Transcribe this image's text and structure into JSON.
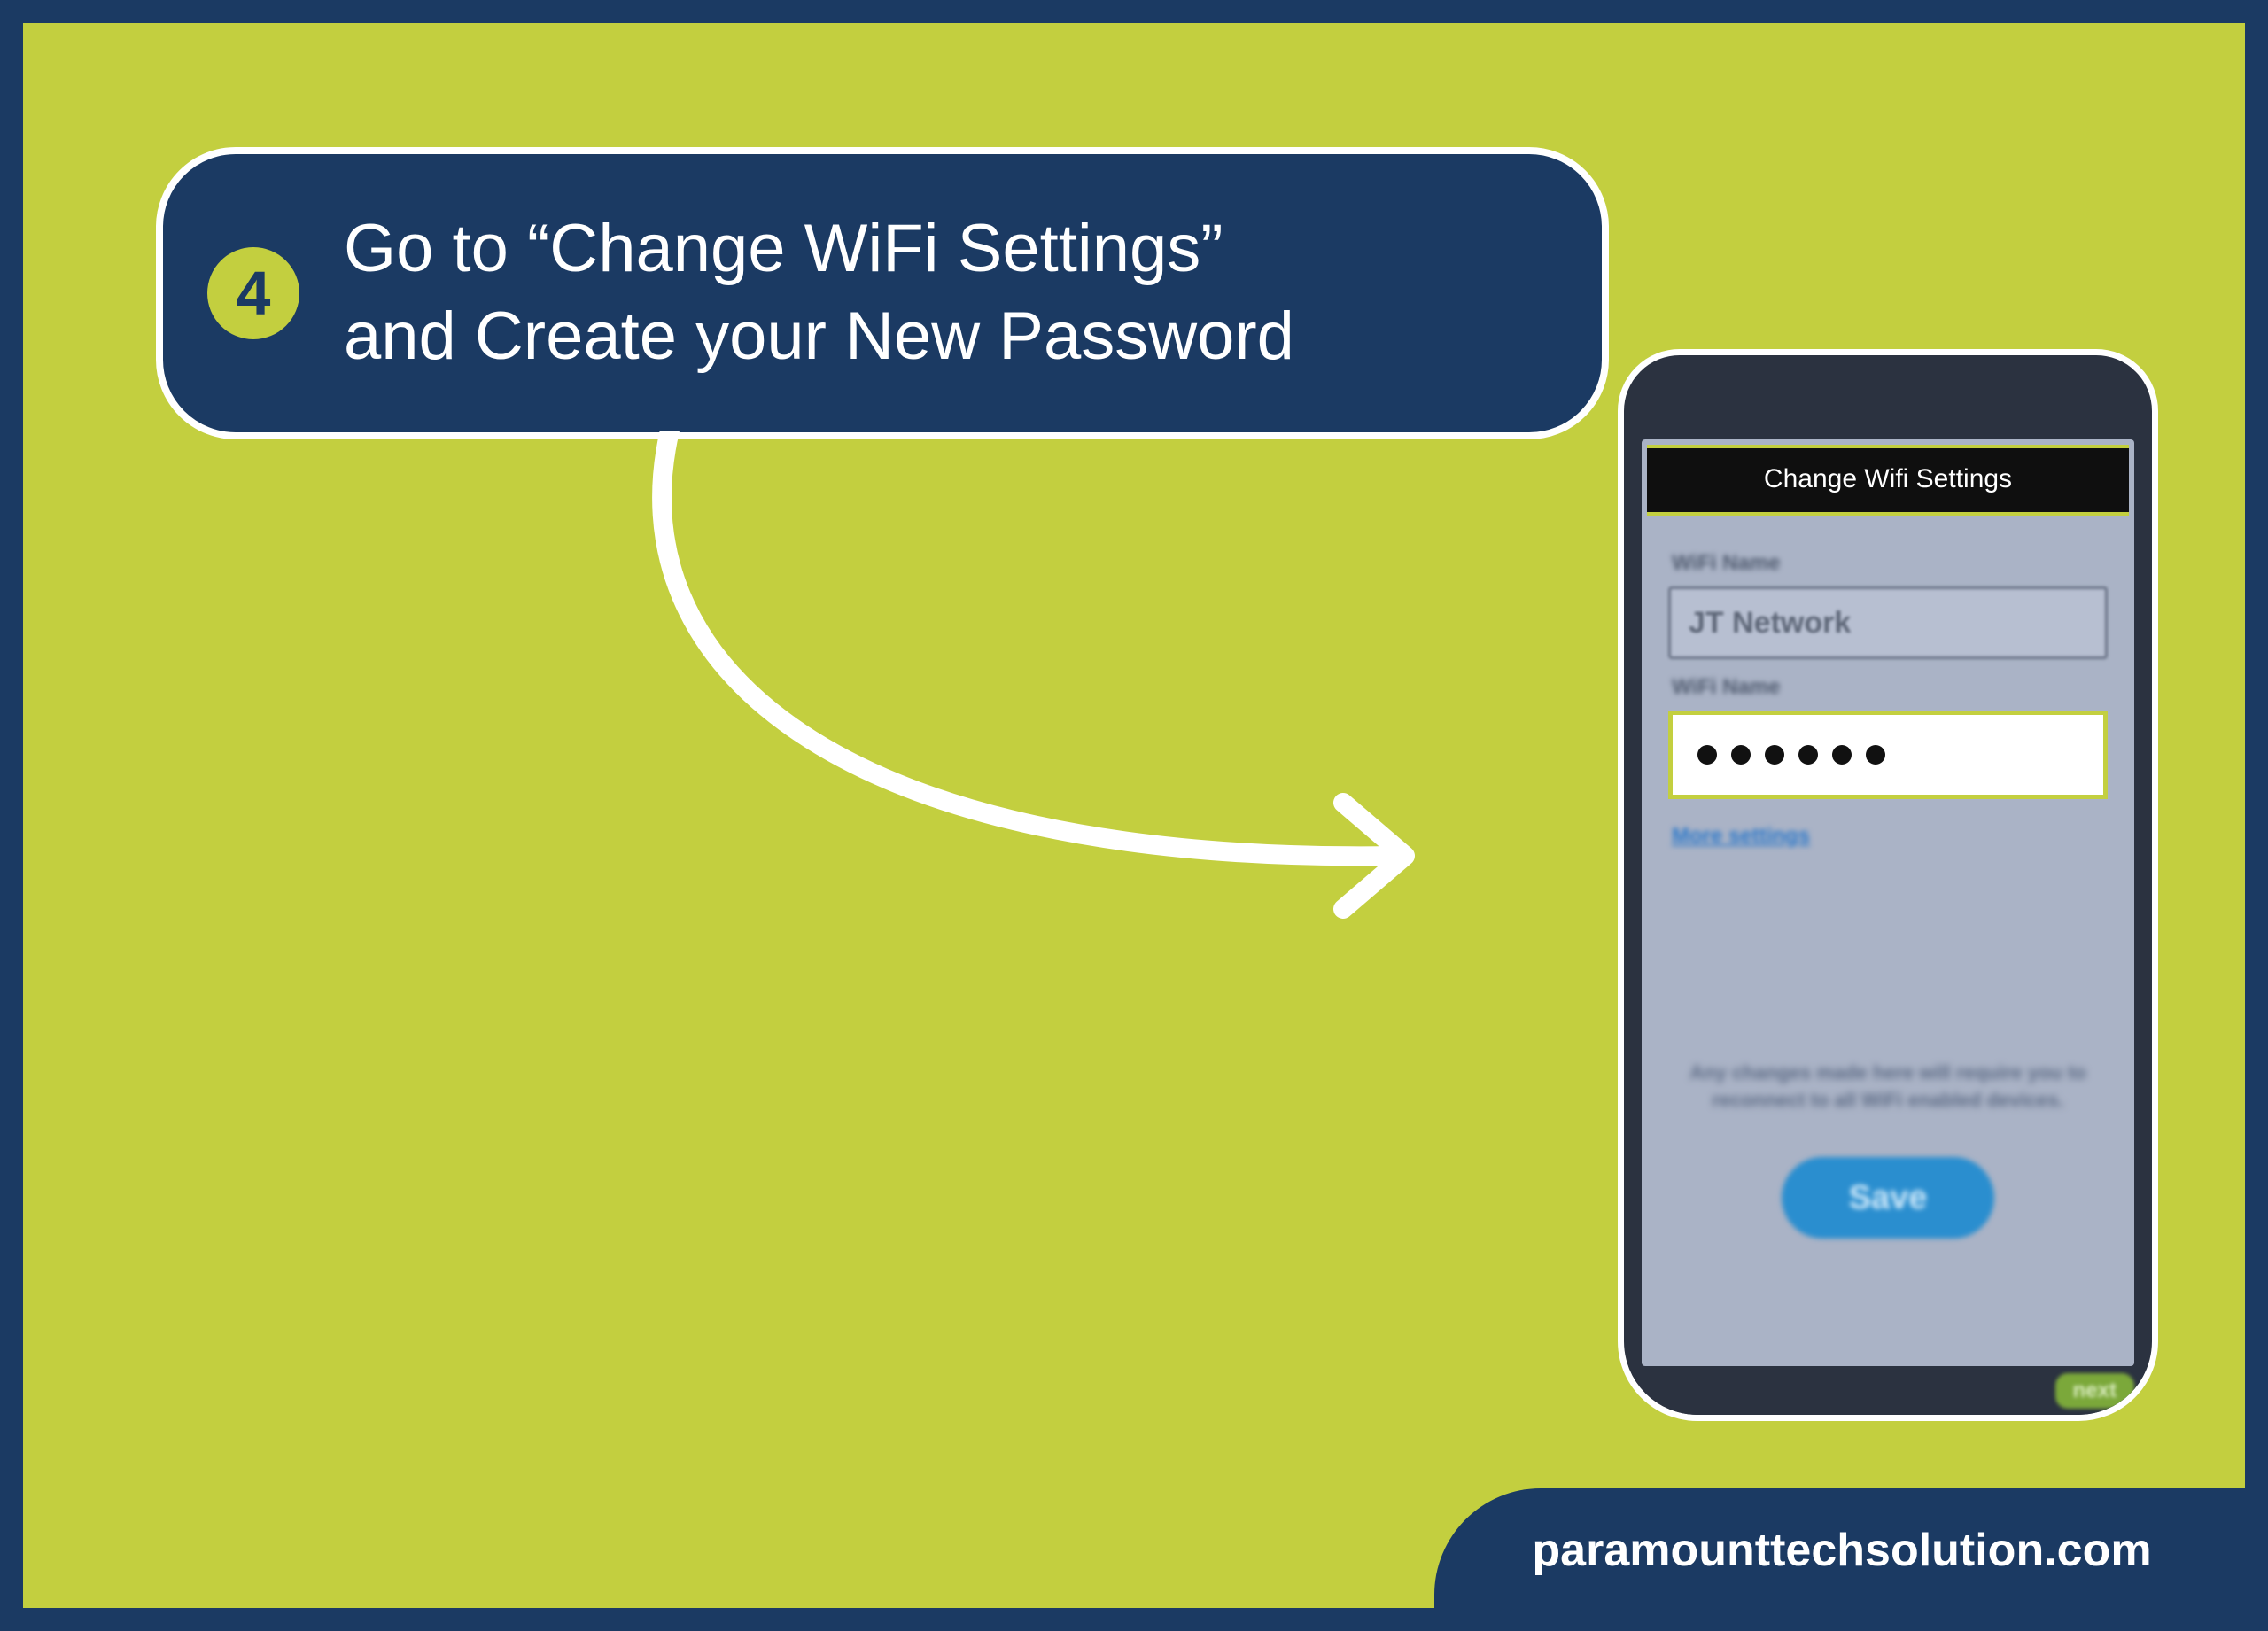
{
  "step": {
    "number": "4",
    "text_line1": "Go to “Change WiFi Settings”",
    "text_line2": "and Create your New Password"
  },
  "phone": {
    "top_label": "",
    "header": "Change Wifi Settings",
    "field1_label": "WiFi Name",
    "field1_value": "JT Network",
    "field2_label": "WiFi Name",
    "more_link": "More settings",
    "disclaimer": "Any changes made here will require you to reconnect to all WiFi enabled devices.",
    "save_label": "Save",
    "next_label": "next"
  },
  "footer": {
    "site": "paramounttechsolution.com"
  },
  "colors": {
    "bg": "#c3cf3f",
    "navy": "#1b3a63"
  }
}
